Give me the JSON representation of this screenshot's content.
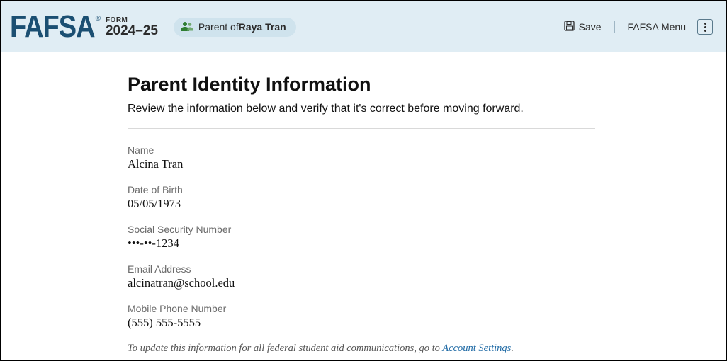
{
  "header": {
    "logo": "FAFSA",
    "form_label": "FORM",
    "year": "2024–25",
    "role_prefix": "Parent of ",
    "student_name": "Raya Tran",
    "save_label": "Save",
    "menu_label": "FAFSA Menu"
  },
  "page": {
    "title": "Parent Identity Information",
    "subtitle": "Review the information below and verify that it's correct before moving forward."
  },
  "fields": {
    "name": {
      "label": "Name",
      "value": "Alcina Tran"
    },
    "dob": {
      "label": "Date of Birth",
      "value": "05/05/1973"
    },
    "ssn": {
      "label": "Social Security Number",
      "value": "•••-••-1234"
    },
    "email": {
      "label": "Email Address",
      "value": "alcinatran@school.edu"
    },
    "phone": {
      "label": "Mobile Phone Number",
      "value": "(555) 555-5555"
    }
  },
  "footer": {
    "note_prefix": "To update this information for all federal student aid communications, go to ",
    "link_text": "Account Settings",
    "suffix": "."
  }
}
